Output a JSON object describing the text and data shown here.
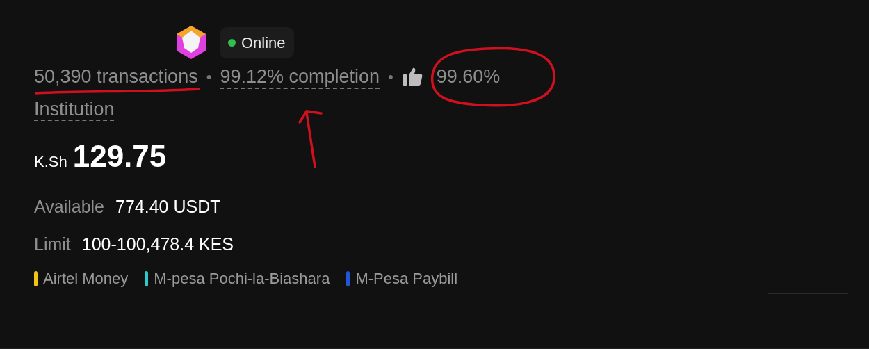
{
  "merchant": {
    "status": "Online",
    "online": true
  },
  "stats": [
    {
      "text": "50,390 transactions",
      "dashed": false
    },
    {
      "text": "99.12% completion",
      "dashed": true
    },
    {
      "text": "99.60%",
      "kind": "rating"
    }
  ],
  "separators": [
    "•",
    "•"
  ],
  "account_type": {
    "text": "Institution",
    "dashed": true
  },
  "price": {
    "currency": "K.Sh",
    "amount": "129.75"
  },
  "details": [
    {
      "label": "Available",
      "value": "774.40 USDT"
    },
    {
      "label": "Limit",
      "value": "100-100,478.4 KES"
    }
  ],
  "payment_methods": [
    {
      "name": "Airtel Money",
      "color": "#f2c311"
    },
    {
      "name": "M-pesa Pochi-la-Biashara",
      "color": "#2ec9c9"
    },
    {
      "name": "M-Pesa Paybill",
      "color": "#1f57d6"
    }
  ],
  "annotations": [
    {
      "kind": "underline"
    },
    {
      "kind": "arrow"
    },
    {
      "kind": "circle"
    }
  ]
}
